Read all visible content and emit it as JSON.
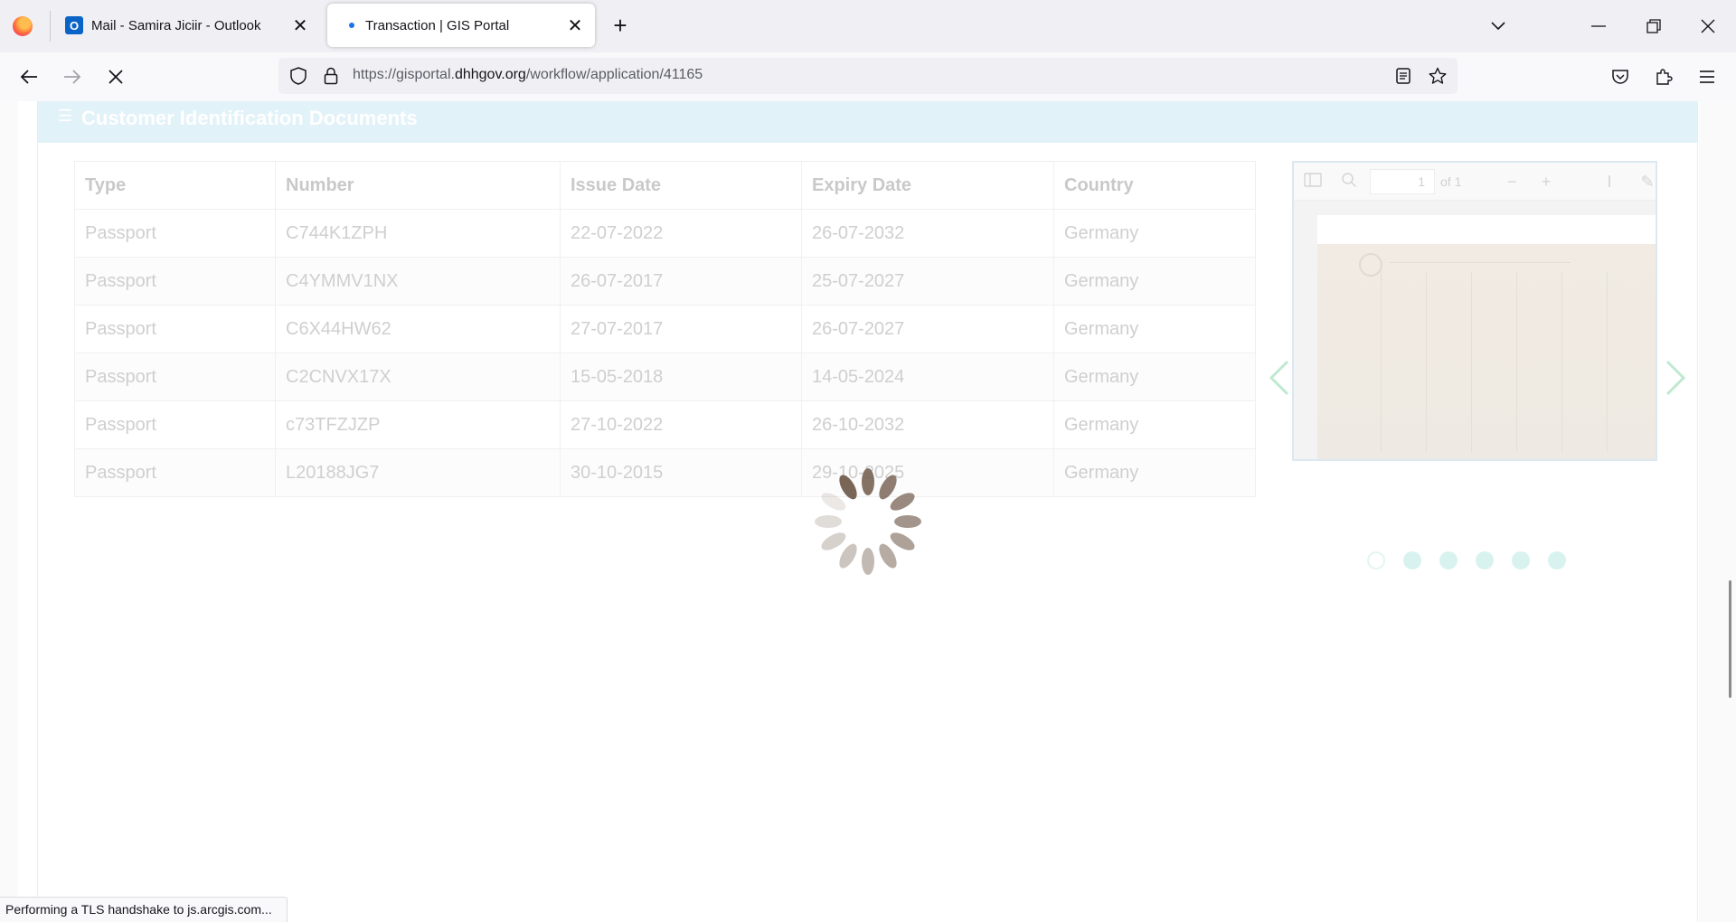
{
  "browser": {
    "tabs": [
      {
        "title": "Mail - Samira Jiciir - Outlook",
        "active": false
      },
      {
        "title": "Transaction | GIS Portal",
        "active": true
      }
    ],
    "url_prefix": "https://gisportal.",
    "url_host": "dhhgov.org",
    "url_path": "/workflow/application/41165",
    "status_text": "Performing a TLS handshake to js.arcgis.com..."
  },
  "section": {
    "title": "Customer Identification Documents",
    "header_color": "#e2f2f9"
  },
  "documents_table": {
    "columns": [
      "Type",
      "Number",
      "Issue Date",
      "Expiry Date",
      "Country"
    ],
    "rows": [
      [
        "Passport",
        "C744K1ZPH",
        "22-07-2022",
        "26-07-2032",
        "Germany"
      ],
      [
        "Passport",
        "C4YMMV1NX",
        "26-07-2017",
        "25-07-2027",
        "Germany"
      ],
      [
        "Passport",
        "C6X44HW62",
        "27-07-2017",
        "26-07-2027",
        "Germany"
      ],
      [
        "Passport",
        "C2CNVX17X",
        "15-05-2018",
        "14-05-2024",
        "Germany"
      ],
      [
        "Passport",
        "c73TFZJZP",
        "27-10-2022",
        "26-10-2032",
        "Germany"
      ],
      [
        "Passport",
        "L20188JG7",
        "30-10-2015",
        "29-10-2025",
        "Germany"
      ]
    ]
  },
  "pdf_viewer": {
    "page_number": "1",
    "page_total": "of 1"
  },
  "carousel": {
    "slide_count": 6,
    "active_index": 0,
    "arrow_color": "#bfe9cf",
    "dot_color": "#d8f3ef"
  },
  "loading_spinner": {
    "visible": true,
    "color": "#7a6657"
  }
}
